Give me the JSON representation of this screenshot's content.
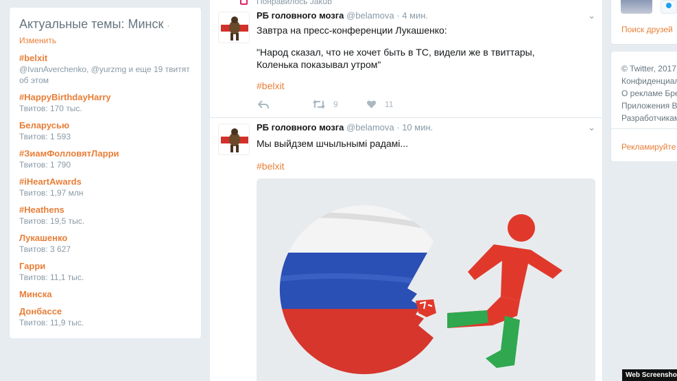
{
  "trends": {
    "title": "Актуальные темы: Минск",
    "title_dot": "·",
    "change_label": "Изменить",
    "items": [
      {
        "name": "#belxit",
        "meta": "@IvanAverchenko, @yurzmg и еще 19 твитят об этом"
      },
      {
        "name": "#HappyBirthdayHarry",
        "meta": "Твитов: 170 тыс."
      },
      {
        "name": "Беларусью",
        "meta": "Твитов: 1 593"
      },
      {
        "name": "#ЗиамФолловятЛарри",
        "meta": "Твитов: 1 790"
      },
      {
        "name": "#iHeartAwards",
        "meta": "Твитов: 1,97 млн"
      },
      {
        "name": "#Heathens",
        "meta": "Твитов: 19,5 тыс."
      },
      {
        "name": "Лукашенко",
        "meta": "Твитов: 3 627"
      },
      {
        "name": "Гарри",
        "meta": "Твитов: 11,1 тыс."
      },
      {
        "name": "Минска",
        "meta": ""
      },
      {
        "name": "Донбассе",
        "meta": "Твитов: 11,9 тыс."
      }
    ]
  },
  "liked_bar": {
    "text": "Понравилось Jakub"
  },
  "tweets": [
    {
      "name": "РБ головного мозга",
      "handle": "@belamova",
      "time": "· 4 мин.",
      "text1": "Завтра на пресс-конференции Лукашенко:",
      "text2": "\"Народ сказал, что не хочет быть в ТС, видели же в твиттары, Коленька показывал утром\"",
      "hashtag": "#belxit",
      "retweets": "9",
      "likes": "11"
    },
    {
      "name": "РБ головного мозга",
      "handle": "@belamova",
      "time": "· 10 мин.",
      "text1": "Мы выйдзем шчыльнымі радамі...",
      "hashtag": "#belxit"
    }
  ],
  "right": {
    "who_link": "Поиск друзей",
    "footer_lines": [
      "© Twitter, 2017",
      "Конфиденциал",
      "О рекламе  Бре",
      "Приложения  В",
      "Разработчикам"
    ],
    "ads_link": "Рекламируйте в"
  },
  "badge": "Web Screenshot",
  "colors": {
    "accent": "#e87e37",
    "muted": "#8899a6",
    "flag_red": "#e0392b",
    "flag_green": "#2fa84f",
    "ru_blue": "#2a4fb5"
  }
}
